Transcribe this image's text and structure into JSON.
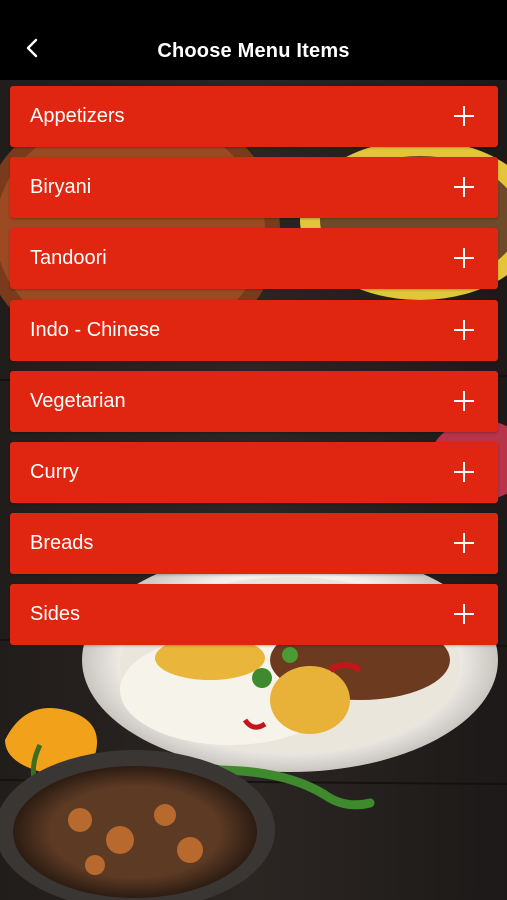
{
  "header": {
    "title": "Choose Menu Items",
    "back_icon": "chevron-left-icon"
  },
  "menu": {
    "items": [
      {
        "label": "Appetizers",
        "icon": "plus-icon"
      },
      {
        "label": "Biryani",
        "icon": "plus-icon"
      },
      {
        "label": "Tandoori",
        "icon": "plus-icon"
      },
      {
        "label": "Indo - Chinese",
        "icon": "plus-icon"
      },
      {
        "label": "Vegetarian",
        "icon": "plus-icon"
      },
      {
        "label": "Curry",
        "icon": "plus-icon"
      },
      {
        "label": "Breads",
        "icon": "plus-icon"
      },
      {
        "label": "Sides",
        "icon": "plus-icon"
      }
    ]
  },
  "colors": {
    "header_bg": "#000000",
    "item_bg": "#e02510",
    "text": "#ffffff"
  }
}
